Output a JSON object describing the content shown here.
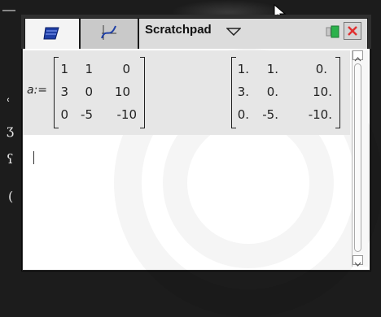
{
  "app": {
    "tabs": [
      {
        "name": "calculator-tab",
        "icon": "calculator-icon"
      },
      {
        "name": "graphs-tab",
        "icon": "graph-icon"
      }
    ],
    "document_title": "Scratchpad"
  },
  "calculation": {
    "label": "a:=",
    "input_matrix": [
      [
        "1",
        "1",
        "0"
      ],
      [
        "3",
        "0",
        "10"
      ],
      [
        "0",
        "-5",
        "-10"
      ]
    ],
    "result_matrix": [
      [
        "1.",
        "1.",
        "0."
      ],
      [
        "3.",
        "0.",
        "10."
      ],
      [
        "0.",
        "-5.",
        "-10."
      ]
    ]
  },
  "colors": {
    "close_button": "#e03030",
    "battery": "#2bb24c",
    "window_bg": "#2a2a2a"
  }
}
